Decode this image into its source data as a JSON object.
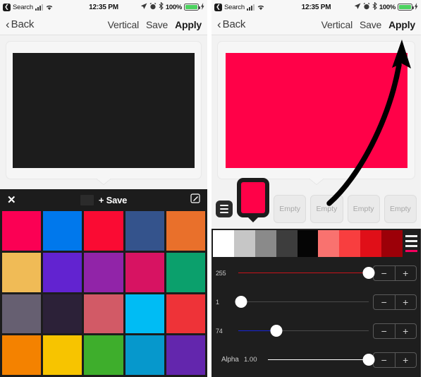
{
  "statusbar": {
    "back_glyph": "❮",
    "carrier": "Search",
    "time": "12:35 PM",
    "battery_pct": "100%",
    "icons": [
      "location-arrow-icon",
      "alarm-icon",
      "bluetooth-icon",
      "battery-icon",
      "charging-bolt-icon"
    ]
  },
  "navbar": {
    "back_chevron": "‹",
    "back_label": "Back",
    "orientation_label": "Vertical",
    "save_label": "Save",
    "apply_label": "Apply"
  },
  "left_screen": {
    "preview_color": "#1c1c1c",
    "toolbar": {
      "close_glyph": "✕",
      "chip_color": "#2b2b2b",
      "save_label": "+ Save",
      "edit_glyph": "✎"
    },
    "swatches": [
      "#fb0054",
      "#0078ec",
      "#fa0b33",
      "#34538c",
      "#e9702b",
      "#f0bb56",
      "#6223d0",
      "#9124a8",
      "#d71362",
      "#0ba06c",
      "#665f71",
      "#2c2138",
      "#d25a66",
      "#00bcf4",
      "#ee3338",
      "#f48200",
      "#f7c400",
      "#3eae2c",
      "#0698cc",
      "#6326ad"
    ]
  },
  "right_screen": {
    "preview_color": "#ff0148",
    "slots": {
      "menu_icon": "hamburger-icon",
      "selected_color": "#ff0148",
      "empty_label": "Empty",
      "empty_count": 4
    },
    "ramp": {
      "colors": [
        "#ffffff",
        "#c6c6c6",
        "#8a8a8a",
        "#3d3d3d",
        "#050505",
        "#f9726f",
        "#f83e3f",
        "#e00f18",
        "#9c0008"
      ],
      "menu_icon": "list-icon",
      "menu_accent": "#f5005e"
    },
    "sliders": [
      {
        "label": "255",
        "value": 255,
        "max": 255,
        "percent": 100,
        "track_color": "#c8131b",
        "name": "red-slider"
      },
      {
        "label": "1",
        "value": 1,
        "max": 255,
        "percent": 2,
        "track_color": "#1d9a2a",
        "name": "green-slider"
      },
      {
        "label": "74",
        "value": 74,
        "max": 255,
        "percent": 29,
        "track_color": "#1724d8",
        "name": "blue-slider"
      }
    ],
    "alpha": {
      "label": "Alpha",
      "value": "1.00",
      "percent": 100,
      "track_color": "#ffffff"
    },
    "stepper": {
      "minus": "−",
      "plus": "+"
    }
  },
  "annotation": {
    "type": "curved-arrow",
    "points_to": "Apply",
    "color": "#000000"
  }
}
